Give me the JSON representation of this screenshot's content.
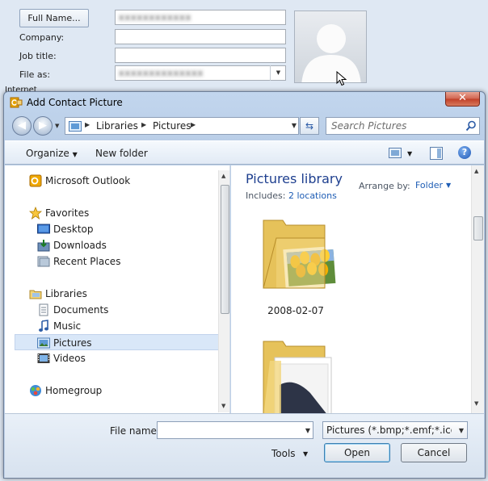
{
  "contact_form": {
    "fullname_button": "Full Name...",
    "fullname_value": "xxxxxxxxxxxx",
    "company_label": "Company:",
    "jobtitle_label": "Job title:",
    "fileas_label": "File as:",
    "fileas_value": "xxxxxxxxxxxxxx",
    "internet_label": "Internet"
  },
  "dialog": {
    "title": "Add Contact Picture",
    "close_glyph": "✕",
    "breadcrumbs": [
      "Libraries",
      "Pictures"
    ],
    "search_placeholder": "Search Pictures",
    "command_bar": {
      "organize": "Organize",
      "new_folder": "New folder"
    },
    "nav": {
      "items": [
        {
          "label": "Microsoft Outlook",
          "icon": "outlook-icon"
        },
        {
          "label": "Favorites",
          "icon": "star-icon"
        },
        {
          "label": "Desktop",
          "icon": "desktop-icon"
        },
        {
          "label": "Downloads",
          "icon": "downloads-icon"
        },
        {
          "label": "Recent Places",
          "icon": "recent-places-icon"
        },
        {
          "label": "Libraries",
          "icon": "libraries-icon"
        },
        {
          "label": "Documents",
          "icon": "documents-icon"
        },
        {
          "label": "Music",
          "icon": "music-icon"
        },
        {
          "label": "Pictures",
          "icon": "pictures-icon"
        },
        {
          "label": "Videos",
          "icon": "videos-icon"
        },
        {
          "label": "Homegroup",
          "icon": "homegroup-icon"
        }
      ],
      "selected": "Pictures"
    },
    "content": {
      "library_title": "Pictures library",
      "includes_label": "Includes:",
      "includes_link": "2 locations",
      "arrange_label": "Arrange by:",
      "arrange_value": "Folder",
      "folders": [
        {
          "name": "2008-02-07"
        },
        {
          "name": ""
        }
      ]
    },
    "footer": {
      "file_name_label": "File name:",
      "file_name_value": "",
      "filter": "Pictures (*.bmp;*.emf;*.ico;*.icon",
      "tools": "Tools",
      "open": "Open",
      "cancel": "Cancel"
    }
  },
  "colors": {
    "accent_link": "#1e5db5",
    "library_title": "#1e3f8f",
    "selection": "#d9e7f8",
    "close_red": "#c13f28"
  }
}
